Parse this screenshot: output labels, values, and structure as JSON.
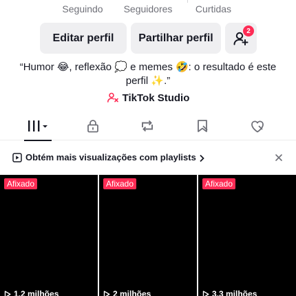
{
  "stats": {
    "following_label": "Seguindo",
    "followers_label": "Seguidores",
    "likes_label": "Curtidas"
  },
  "actions": {
    "edit_profile": "Editar perfil",
    "share_profile": "Partilhar perfil",
    "friend_requests_count": "2"
  },
  "bio": {
    "text": "“Humor 😂, reflexão 💭 e memes 🤣: o resultado é este perfil ✨.”"
  },
  "studio": {
    "label": "TikTok Studio"
  },
  "tabs": [
    {
      "icon": "videos-grid-icon",
      "active": true
    },
    {
      "icon": "lock-icon",
      "active": false
    },
    {
      "icon": "repost-icon",
      "active": false
    },
    {
      "icon": "saved-icon",
      "active": false
    },
    {
      "icon": "liked-icon",
      "active": false
    }
  ],
  "playlist_banner": {
    "text": "Obtém mais visualizações com playlists"
  },
  "videos": [
    {
      "pinned_label": "Afixado",
      "views": "1,2 milhões"
    },
    {
      "pinned_label": "Afixado",
      "views": "2 milhões"
    },
    {
      "pinned_label": "Afixado",
      "views": "3,3 milhões"
    }
  ],
  "colors": {
    "accent": "#fe2c55",
    "button_bg": "#efeff1",
    "text": "#161823",
    "muted": "#6f7078"
  }
}
